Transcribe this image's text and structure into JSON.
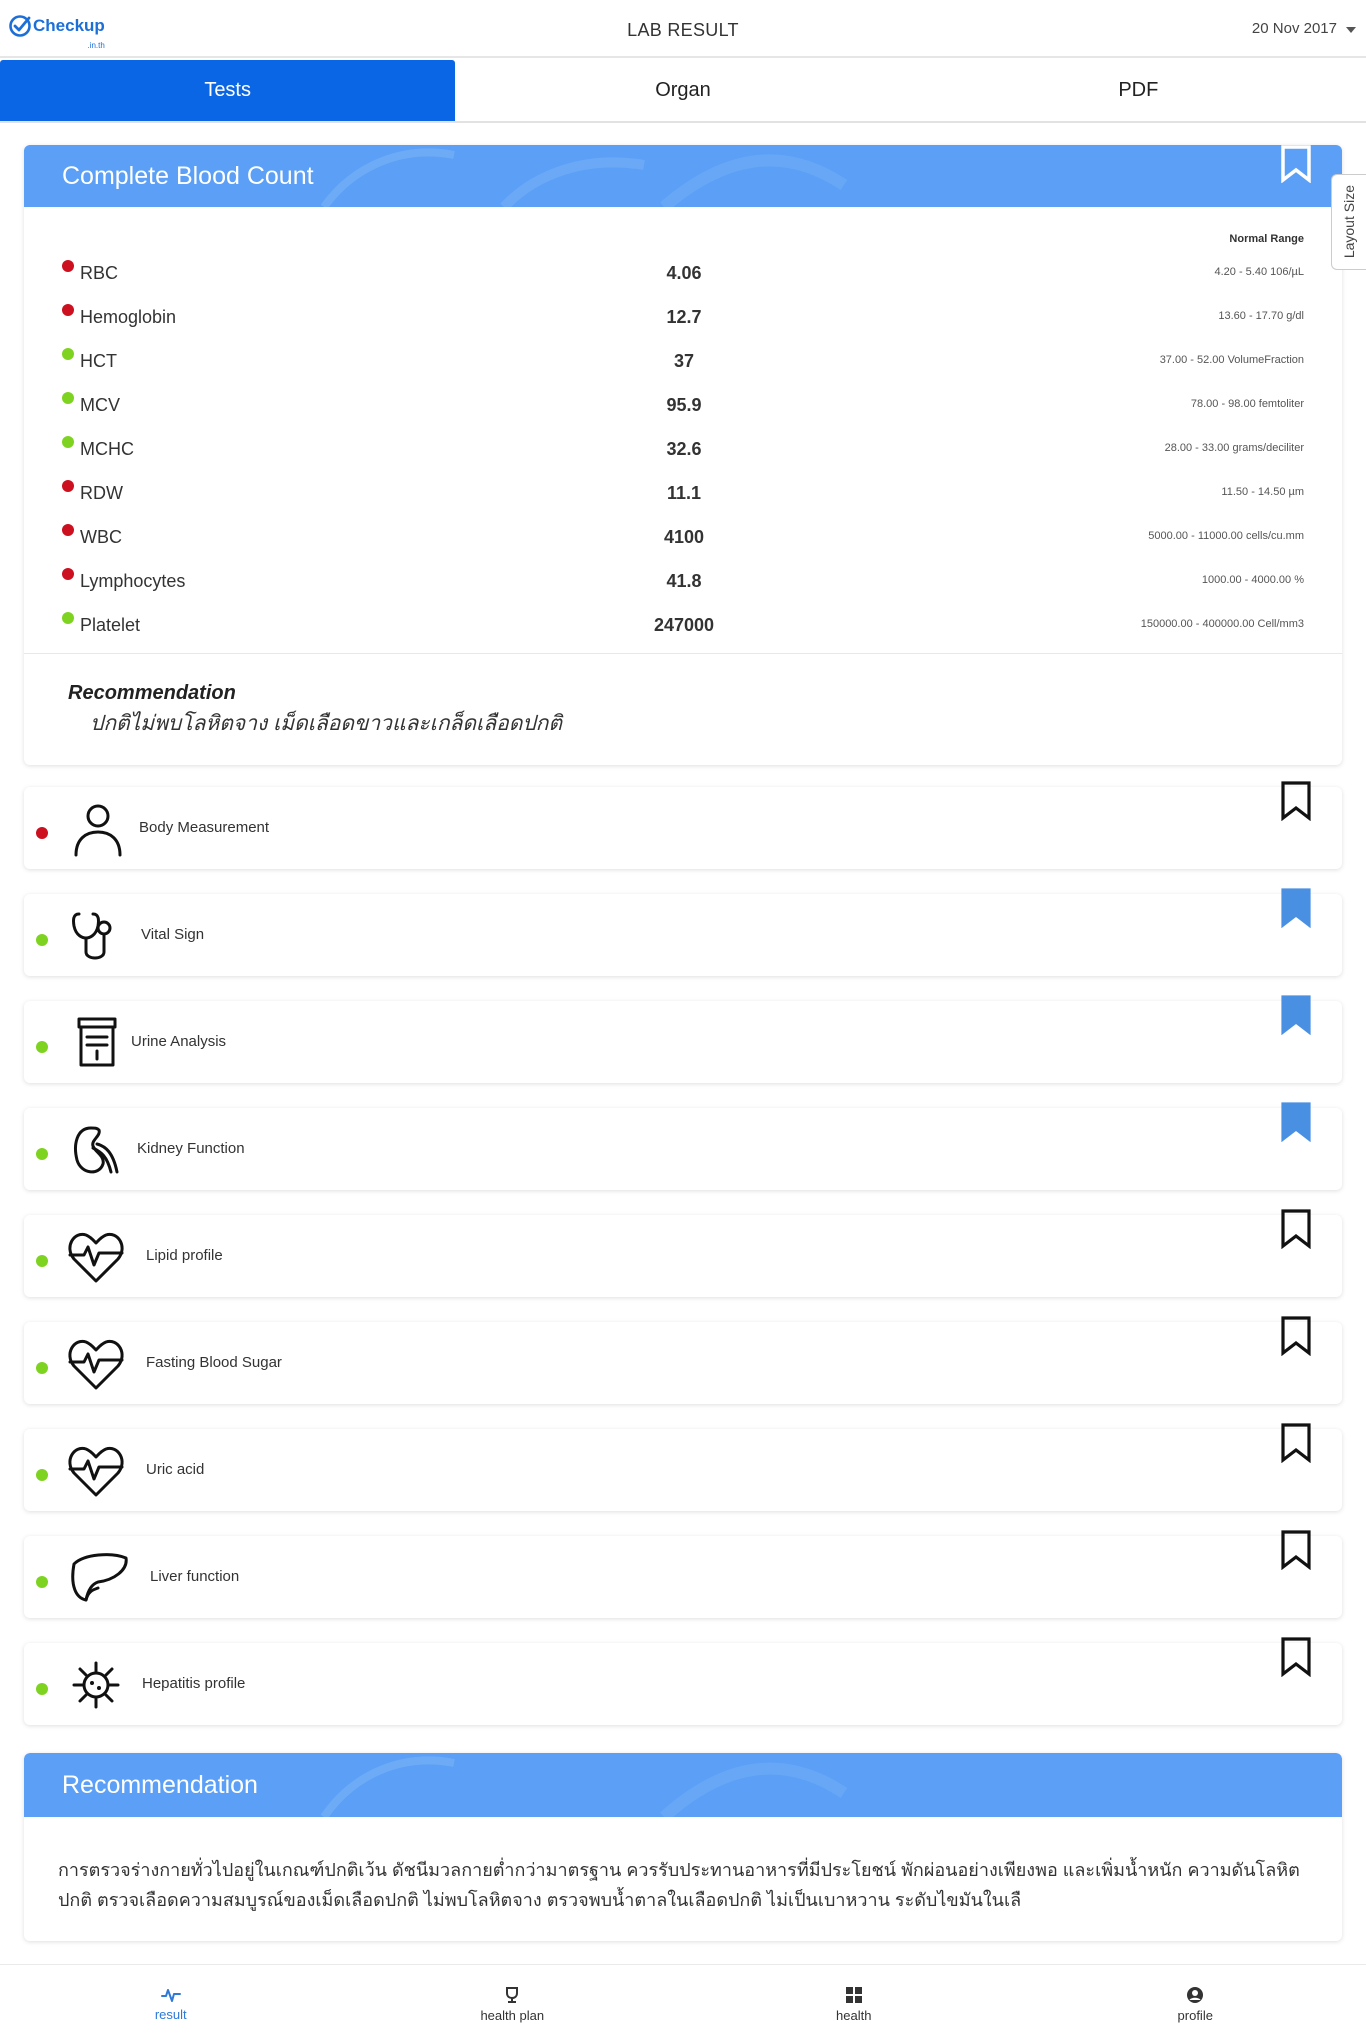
{
  "header": {
    "logo_text": "Checkup",
    "logo_sub": ".in.th",
    "title": "LAB RESULT",
    "date": "20 Nov 2017"
  },
  "tabs": [
    {
      "label": "Tests",
      "active": true
    },
    {
      "label": "Organ",
      "active": false
    },
    {
      "label": "PDF",
      "active": false
    }
  ],
  "side_tab": {
    "label": "Layout Size"
  },
  "cbc": {
    "title": "Complete Blood Count",
    "normal_range_label": "Normal Range",
    "bookmarked": false,
    "rows": [
      {
        "name": "RBC",
        "value": "4.06",
        "range": "4.20 - 5.40 106/µL",
        "status": "red"
      },
      {
        "name": "Hemoglobin",
        "value": "12.7",
        "range": "13.60 - 17.70 g/dl",
        "status": "red"
      },
      {
        "name": "HCT",
        "value": "37",
        "range": "37.00 - 52.00 VolumeFraction",
        "status": "green"
      },
      {
        "name": "MCV",
        "value": "95.9",
        "range": "78.00 - 98.00 femtoliter",
        "status": "green"
      },
      {
        "name": "MCHC",
        "value": "32.6",
        "range": "28.00 - 33.00 grams/deciliter",
        "status": "green"
      },
      {
        "name": "RDW",
        "value": "11.1",
        "range": "11.50 - 14.50 µm",
        "status": "red"
      },
      {
        "name": "WBC",
        "value": "4100",
        "range": "5000.00 - 11000.00 cells/cu.mm",
        "status": "red"
      },
      {
        "name": "Lymphocytes",
        "value": "41.8",
        "range": "1000.00 - 4000.00 %",
        "status": "red"
      },
      {
        "name": "Platelet",
        "value": "247000",
        "range": "150000.00 - 400000.00 Cell/mm3",
        "status": "green"
      }
    ],
    "recommendation_title": "Recommendation",
    "recommendation_text": "ปกติไม่พบโลหิตจาง เม็ดเลือดขาวและเกล็ดเลือดปกติ"
  },
  "sections": [
    {
      "label": "Body Measurement",
      "icon": "person-icon",
      "status": "red",
      "bookmarked": false
    },
    {
      "label": "Vital Sign",
      "icon": "stethoscope-icon",
      "status": "green",
      "bookmarked": true
    },
    {
      "label": "Urine Analysis",
      "icon": "urine-cup-icon",
      "status": "green",
      "bookmarked": true
    },
    {
      "label": "Kidney Function",
      "icon": "kidney-icon",
      "status": "green",
      "bookmarked": true
    },
    {
      "label": "Lipid profile",
      "icon": "heart-pulse-icon",
      "status": "green",
      "bookmarked": false
    },
    {
      "label": "Fasting Blood Sugar",
      "icon": "heart-pulse-icon",
      "status": "green",
      "bookmarked": false
    },
    {
      "label": "Uric acid",
      "icon": "heart-pulse-icon",
      "status": "green",
      "bookmarked": false
    },
    {
      "label": "Liver function",
      "icon": "liver-icon",
      "status": "green",
      "bookmarked": false
    },
    {
      "label": "Hepatitis profile",
      "icon": "virus-icon",
      "status": "green",
      "bookmarked": false
    }
  ],
  "recommendation": {
    "title": "Recommendation",
    "text": "การตรวจร่างกายทั่วไปอยู่ในเกณฑ์ปกติเว้น ดัชนีมวลกายต่ำกว่ามาตรฐาน ควรรับประทานอาหารที่มีประโยชน์ พักผ่อนอย่างเพียงพอ และเพิ่มน้ำหนัก ความดันโลหิตปกติ ตรวจเลือดความสมบูรณ์ของเม็ดเลือดปกติ ไม่พบโลหิตจาง ตรวจพบน้ำตาลในเลือดปกติ ไม่เป็นเบาหวาน ระดับไขมันในเลื"
  },
  "bottom_nav": [
    {
      "label": "result",
      "icon": "pulse-icon",
      "active": true
    },
    {
      "label": "health plan",
      "icon": "trophy-icon",
      "active": false
    },
    {
      "label": "health",
      "icon": "grid-icon",
      "active": false
    },
    {
      "label": "profile",
      "icon": "user-circle-icon",
      "active": false
    }
  ],
  "colors": {
    "primary": "#0a66e4",
    "card_header": "#5ba0f6",
    "status_red": "#cc1020",
    "status_green": "#7ed321",
    "bookmark_active": "#4a90e2"
  }
}
